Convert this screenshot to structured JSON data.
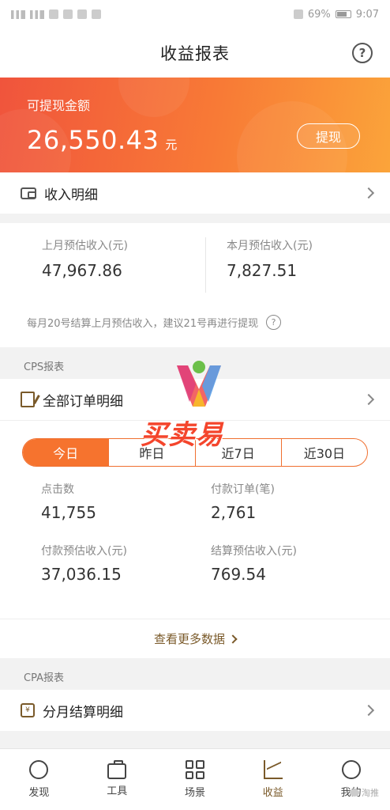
{
  "status_bar": {
    "battery": "69%",
    "time": "9:07"
  },
  "nav": {
    "title": "收益报表",
    "help_symbol": "?"
  },
  "balance": {
    "label": "可提现金额",
    "amount": "26,550.43",
    "unit": "元",
    "withdraw_label": "提现"
  },
  "income_detail": {
    "label": "收入明细",
    "icon": "wallet-icon"
  },
  "monthly": {
    "last_month_label": "上月预估收入(元)",
    "last_month_value": "47,967.86",
    "this_month_label": "本月预估收入(元)",
    "this_month_value": "7,827.51",
    "note": "每月20号结算上月预估收入，建议21号再进行提现",
    "note_icon": "?"
  },
  "cps": {
    "section_title": "CPS报表",
    "orders_label": "全部订单明细",
    "tabs": [
      "今日",
      "昨日",
      "近7日",
      "近30日"
    ],
    "active_tab": 0,
    "stats": {
      "clicks_label": "点击数",
      "clicks_value": "41,755",
      "paid_orders_label": "付款订单(笔)",
      "paid_orders_value": "2,761",
      "paid_income_label": "付款预估收入(元)",
      "paid_income_value": "37,036.15",
      "settled_income_label": "结算预估收入(元)",
      "settled_income_value": "769.54"
    },
    "more_label": "查看更多数据"
  },
  "cpa": {
    "section_title": "CPA报表",
    "monthly_label": "分月结算明细",
    "icon_char": "¥"
  },
  "tab_bar": {
    "items": [
      {
        "label": "发现",
        "icon": "discover-icon"
      },
      {
        "label": "工具",
        "icon": "toolbox-icon"
      },
      {
        "label": "场景",
        "icon": "scene-grid-icon"
      },
      {
        "label": "收益",
        "icon": "earnings-chart-icon"
      },
      {
        "label": "我的",
        "icon": "profile-icon"
      }
    ],
    "active_index": 3
  },
  "watermark": {
    "text": "买卖易",
    "wechat_text": "淘推"
  },
  "colors": {
    "accent": "#f6732e",
    "brand_brown": "#7a5a2a",
    "gradient_start": "#f0543c",
    "gradient_end": "#fba43a"
  }
}
